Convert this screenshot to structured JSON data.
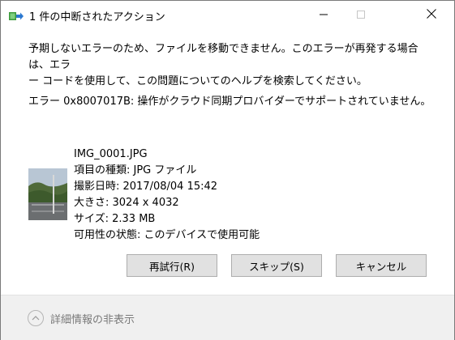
{
  "window": {
    "title": "1 件の中断されたアクション",
    "icon": "file-transfer-icon"
  },
  "controls": {
    "minimize_icon": "minimize-icon",
    "maximize_icon": "maximize-icon",
    "close_icon": "close-icon"
  },
  "message": {
    "line1": "予期しないエラーのため、ファイルを移動できません。このエラーが再発する場合は、エラ",
    "line2": "ー コードを使用して、この問題についてのヘルプを検索してください。",
    "error": "エラー 0x8007017B: 操作がクラウド同期プロバイダーでサポートされていません。"
  },
  "file": {
    "name": "IMG_0001.JPG",
    "type": "項目の種類: JPG ファイル",
    "date_taken": "撮影日時: 2017/08/04 15:42",
    "dimensions": "大きさ: 3024 x 4032",
    "size": "サイズ: 2.33 MB",
    "availability": "可用性の状態: このデバイスで使用可能"
  },
  "buttons": {
    "retry": "再試行(R)",
    "skip": "スキップ(S)",
    "cancel": "キャンセル"
  },
  "footer": {
    "details_label": "詳細情報の非表示",
    "details_icon": "chevron-up-icon"
  }
}
